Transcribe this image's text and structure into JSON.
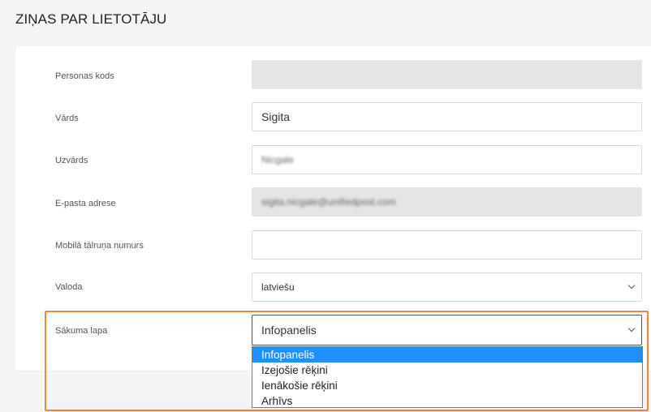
{
  "page": {
    "title": "ZIŅAS PAR LIETOTĀJU"
  },
  "form": {
    "personal_code": {
      "label": "Personas kods",
      "value": ""
    },
    "first_name": {
      "label": "Vārds",
      "value": "Sigita"
    },
    "last_name": {
      "label": "Uzvārds",
      "value": "Nicgale"
    },
    "email": {
      "label": "E-pasta adrese",
      "value": "sigita.nicgale@unifiedpost.com"
    },
    "mobile": {
      "label": "Mobilā tālruņa numurs",
      "value": ""
    },
    "language": {
      "label": "Valoda",
      "value": "latviešu"
    },
    "start_page": {
      "label": "Sākuma lapa",
      "value": "Infopanelis",
      "options": [
        "Infopanelis",
        "Izejošie rēķini",
        "Ienākošie rēķini",
        "Arhīvs"
      ]
    }
  },
  "colors": {
    "highlight": "#f5843a",
    "selected_option": "#1e90ff"
  }
}
